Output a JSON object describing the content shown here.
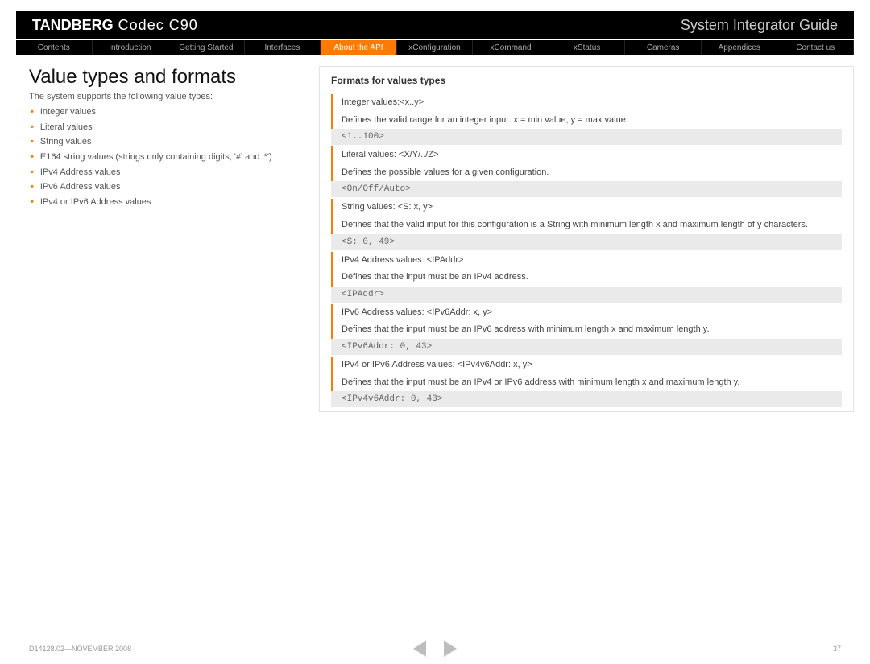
{
  "header": {
    "brand_bold": "TANDBERG",
    "brand_light": " Codec C90",
    "guide": "System Integrator Guide"
  },
  "nav": [
    {
      "label": "Contents",
      "active": false
    },
    {
      "label": "Introduction",
      "active": false
    },
    {
      "label": "Getting Started",
      "active": false
    },
    {
      "label": "Interfaces",
      "active": false
    },
    {
      "label": "About the API",
      "active": true
    },
    {
      "label": "xConfiguration",
      "active": false
    },
    {
      "label": "xCommand",
      "active": false
    },
    {
      "label": "xStatus",
      "active": false
    },
    {
      "label": "Cameras",
      "active": false
    },
    {
      "label": "Appendices",
      "active": false
    },
    {
      "label": "Contact us",
      "active": false
    }
  ],
  "left": {
    "title": "Value types and formats",
    "intro": "The system supports the following value types:",
    "bullets": [
      "Integer values",
      "Literal values",
      "String values",
      "E164 string values (strings only containing digits, '#' and '*')",
      "IPv4 Address values",
      "IPv6 Address values",
      "IPv4 or IPv6 Address values"
    ]
  },
  "right": {
    "subhead": "Formats for values types",
    "groups": [
      {
        "t1": "Integer values:<x..y>",
        "t2": "Defines the valid range for an integer input. x = min value, y = max value.",
        "code": "<1..100>"
      },
      {
        "t1": "Literal values: <X/Y/../Z>",
        "t2": "Defines the possible values for a given configuration.",
        "code": "<On/Off/Auto>"
      },
      {
        "t1": "String values: <S: x, y>",
        "t2": "Defines that the valid input for this configuration is a String with minimum length x and maximum length of y characters.",
        "code": "<S: 0, 49>"
      },
      {
        "t1": "IPv4 Address values: <IPAddr>",
        "t2": "Defines that the input must be an IPv4 address.",
        "code": "<IPAddr>"
      },
      {
        "t1": "IPv6 Address values: <IPv6Addr: x, y>",
        "t2": "Defines that the input must be an IPv6 address with minimum length x and maximum length y.",
        "code": "<IPv6Addr: 0, 43>"
      },
      {
        "t1": "IPv4 or IPv6 Address values: <IPv4v6Addr: x, y>",
        "t2": "Defines that the input must be an IPv4 or IPv6 address with minimum length x and maximum length y.",
        "code": "<IPv4v6Addr: 0, 43>"
      }
    ]
  },
  "footer": {
    "docref": "D14128.02—NOVEMBER 2008",
    "page": "37"
  }
}
